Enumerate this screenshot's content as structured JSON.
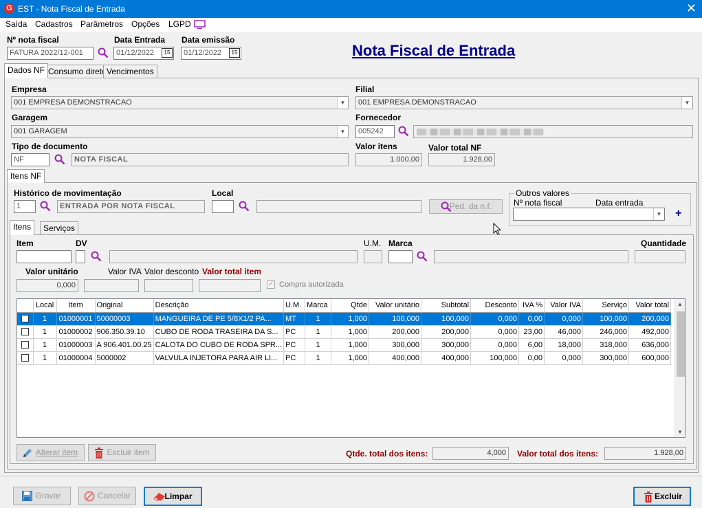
{
  "window": {
    "app_icon": "G",
    "title": "EST - Nota Fiscal de Entrada",
    "close": "✕"
  },
  "menu": [
    "Saída",
    "Cadastros",
    "Parâmetros",
    "Opções",
    "LGPD"
  ],
  "header": {
    "nf_label": "Nº nota fiscal",
    "nf_value": "FATURA 2022/12-001",
    "data_entrada_label": "Data Entrada",
    "data_entrada_value": "01/12/2022",
    "data_emissao_label": "Data emissão",
    "data_emissao_value": "01/12/2022",
    "page_title": "Nota Fiscal de Entrada",
    "calendar_glyph": "15"
  },
  "main_tabs": [
    "Dados NF",
    "Consumo direto",
    "Vencimentos"
  ],
  "dados": {
    "empresa_label": "Empresa",
    "empresa_value": "001 EMPRESA DEMONSTRACAO",
    "filial_label": "Filial",
    "filial_value": "001 EMPRESA DEMONSTRACAO",
    "garagem_label": "Garagem",
    "garagem_value": "001 GARAGEM",
    "fornecedor_label": "Fornecedor",
    "fornecedor_code": "005242",
    "tipo_label": "Tipo de documento",
    "tipo_code": "NF",
    "tipo_desc": "NOTA FISCAL",
    "valor_itens_label": "Valor itens",
    "valor_itens_value": "1.000,00",
    "valor_total_label": "Valor total NF",
    "valor_total_value": "1.928,00"
  },
  "itens_tab": "Itens NF",
  "mov": {
    "historico_label": "Histórico de movimentação",
    "historico_code": "1",
    "historico_desc": "ENTRADA POR NOTA FISCAL",
    "local_label": "Local",
    "ped_button": "Ped. da n.f."
  },
  "outros": {
    "title": "Outros valores",
    "nf_label": "Nº nota fiscal",
    "data_label": "Data entrada",
    "add": "+"
  },
  "sub_tabs": [
    "Itens",
    "Serviços"
  ],
  "item_form": {
    "item_label": "Item",
    "dv_label": "DV",
    "um_label": "U.M.",
    "marca_label": "Marca",
    "qtde_label": "Quantidade",
    "valor_unit_label": "Valor unitário",
    "valor_unit_value": "0,000",
    "iva_label": "Valor IVA",
    "desconto_label": "Valor desconto",
    "total_item_label": "Valor total item",
    "compra_label": "Compra autorizada"
  },
  "grid": {
    "columns": [
      "",
      "Local",
      "Item",
      "Original",
      "Descrição",
      "U.M.",
      "Marca",
      "Qtde",
      "Valor unitário",
      "Subtotal",
      "Desconto",
      "IVA %",
      "Valor IVA",
      "Serviço",
      "Valor total"
    ],
    "rows": [
      [
        "",
        "1",
        "01000001",
        "50000003",
        "MANGUEIRA DE PE 5/8X1/2  PA...",
        "MT",
        "1",
        "1,000",
        "100,000",
        "100,000",
        "0,000",
        "0,00",
        "0,000",
        "100,000",
        "200,000"
      ],
      [
        "",
        "1",
        "01000002",
        "906.350.39.10",
        "CUBO DE RODA TRASEIRA DA S...",
        "PC",
        "1",
        "1,000",
        "200,000",
        "200,000",
        "0,000",
        "23,00",
        "46,000",
        "246,000",
        "492,000"
      ],
      [
        "",
        "1",
        "01000003",
        "A 906.401.00.25",
        "CALOTA DO CUBO DE RODA SPR...",
        "PC",
        "1",
        "1,000",
        "300,000",
        "300,000",
        "0,000",
        "6,00",
        "18,000",
        "318,000",
        "636,000"
      ],
      [
        "",
        "1",
        "01000004",
        "5000002",
        "VALVULA INJETORA PARA AIR LI...",
        "PC",
        "1",
        "1,000",
        "400,000",
        "400,000",
        "100,000",
        "0,00",
        "0,000",
        "300,000",
        "600,000"
      ]
    ],
    "selected_row": 0
  },
  "bottom": {
    "alterar": "Alterar item",
    "excluir_item": "Excluir item",
    "qtde_total_label": "Qtde. total dos itens:",
    "qtde_total_value": "4,000",
    "valor_total_label": "Valor total dos itens:",
    "valor_total_value": "1.928,00"
  },
  "footer": {
    "gravar": "Gravar",
    "cancelar": "Cancelar",
    "limpar": "Limpar",
    "excluir": "Excluir"
  },
  "colors": {
    "title_bar": "#0078d7",
    "heading": "#00008b",
    "selection": "#0078d7",
    "accent_red": "#8b0000",
    "search_icon": "#9c27b0"
  }
}
